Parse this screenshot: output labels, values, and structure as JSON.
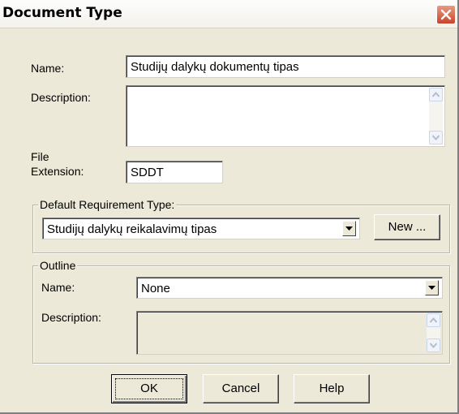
{
  "window": {
    "title": "Document Type"
  },
  "general": {
    "name_label": "Name:",
    "name_value": "Studijų dalykų dokumentų tipas",
    "description_label": "Description:",
    "description_value": "",
    "file_label_line1": "File",
    "file_label_line2": "Extension:",
    "file_extension_value": "SDDT"
  },
  "default_requirement": {
    "legend": "Default Requirement Type:",
    "selected": "Studijų dalykų reikalavimų tipas",
    "new_button": "New ..."
  },
  "outline": {
    "legend": "Outline",
    "name_label": "Name:",
    "name_selected": "None",
    "description_label": "Description:",
    "description_value": ""
  },
  "buttons": {
    "ok": "OK",
    "cancel": "Cancel",
    "help": "Help"
  },
  "icons": {
    "close": "close-icon",
    "scroll_up": "scroll-up-arrow-icon",
    "scroll_down": "scroll-down-arrow-icon",
    "dropdown": "chevron-down-icon"
  },
  "colors": {
    "dialog_bg": "#ece9d8",
    "close_button": "#c8452a"
  }
}
